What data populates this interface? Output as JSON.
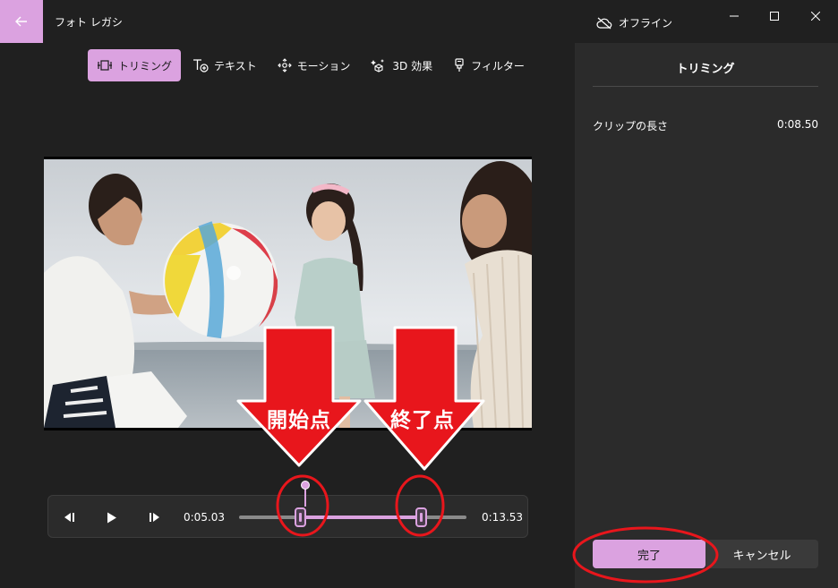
{
  "app": {
    "title": "フォト レガシ"
  },
  "status": {
    "offline_label": "オフライン"
  },
  "toolbar": {
    "items": [
      {
        "label": "トリミング",
        "icon": "trim-icon",
        "active": true
      },
      {
        "label": "テキスト",
        "icon": "text-icon",
        "active": false
      },
      {
        "label": "モーション",
        "icon": "motion-icon",
        "active": false
      },
      {
        "label": "3D 効果",
        "icon": "3d-effects-icon",
        "active": false
      },
      {
        "label": "フィルター",
        "icon": "filter-icon",
        "active": false
      }
    ]
  },
  "player": {
    "start_time": "0:05.03",
    "end_time": "0:13.53"
  },
  "panel": {
    "title": "トリミング",
    "clip_length_label": "クリップの長さ",
    "clip_length_value": "0:08.50",
    "done_label": "完了",
    "cancel_label": "キャンセル"
  },
  "annotations": {
    "start_point_label": "開始点",
    "end_point_label": "終了点"
  },
  "colors": {
    "accent": "#dba2e0",
    "annotation_red": "#e8161c",
    "background": "#202020",
    "panel": "#2b2b2b"
  }
}
